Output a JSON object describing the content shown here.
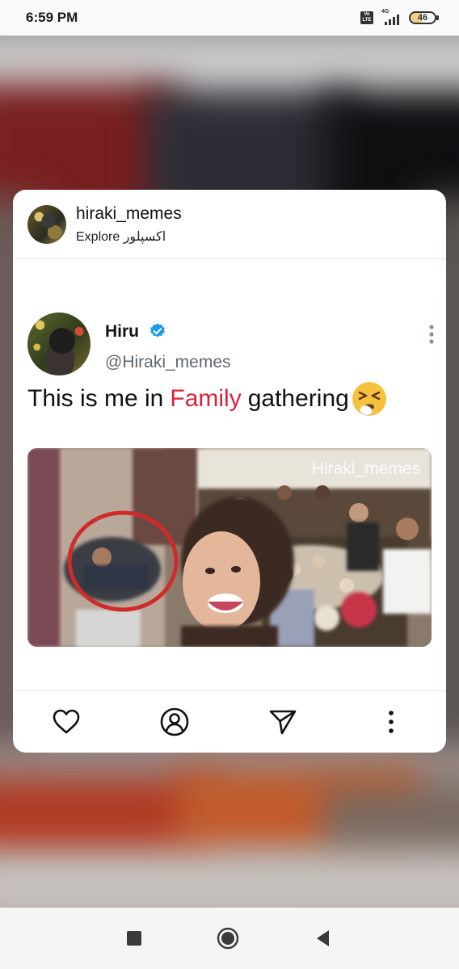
{
  "status_bar": {
    "time": "6:59 PM",
    "volte": "Vo LTE",
    "network": "4G",
    "battery": "46"
  },
  "card": {
    "header": {
      "username": "hiraki_memes",
      "subtitle": "Explore اکسپلور"
    },
    "tweet": {
      "author_name": "Hiru",
      "author_handle": "@Hiraki_memes",
      "text_before": "This is me in",
      "text_highlight": "Family",
      "text_after": "gathering",
      "highlight_color": "#d9233b",
      "emoji": "sneezing-face-emoji",
      "image_watermark": "Hiraki_memes"
    },
    "actions": [
      "like-icon",
      "profile-icon",
      "share-icon",
      "more-icon"
    ]
  },
  "nav_bar": {
    "items": [
      "recents-icon",
      "home-icon",
      "back-icon"
    ]
  },
  "colors": {
    "verified": "#1d9bf0",
    "handle": "#5e6770",
    "card_bg": "#ffffff"
  }
}
